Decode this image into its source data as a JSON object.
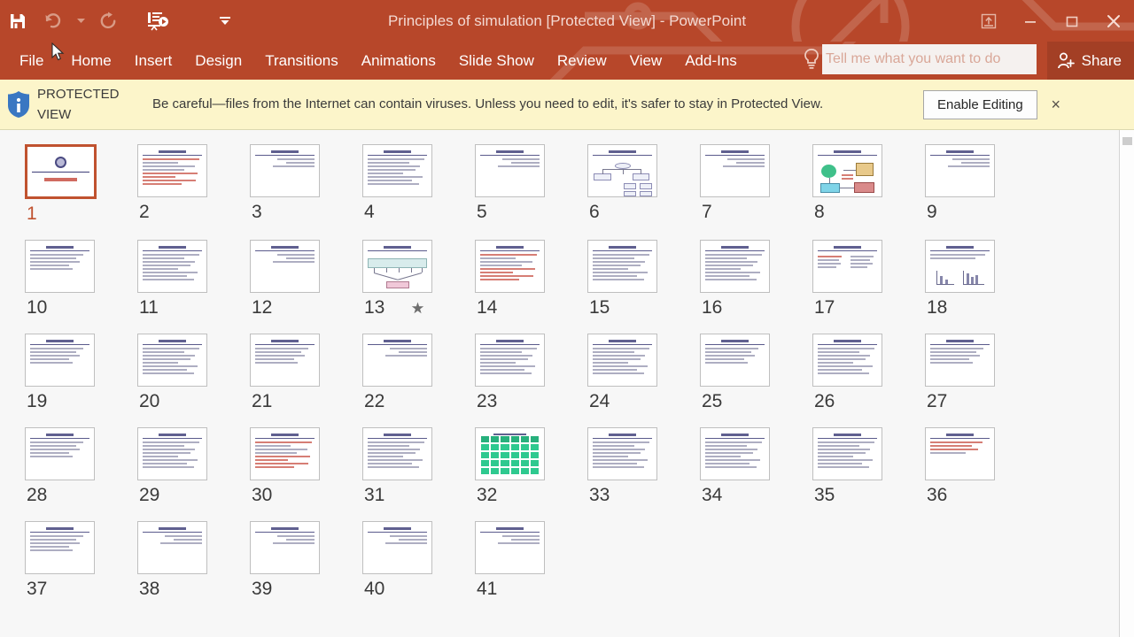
{
  "titlebar": {
    "title": "Principles of simulation [Protected View] - PowerPoint",
    "accent_color": "#b7472a",
    "quick_access": [
      {
        "name": "save-icon",
        "label": "Save",
        "enabled": true
      },
      {
        "name": "undo-icon",
        "label": "Undo",
        "enabled": false
      },
      {
        "name": "undo-dropdown-icon",
        "label": "Undo options",
        "enabled": false
      },
      {
        "name": "redo-icon",
        "label": "Redo",
        "enabled": false
      },
      {
        "name": "start-slideshow-icon",
        "label": "Start From Beginning",
        "enabled": true
      },
      {
        "name": "customize-qat-icon",
        "label": "Customize Quick Access Toolbar",
        "enabled": true
      }
    ],
    "window_controls": [
      {
        "name": "ribbon-display-options-icon",
        "label": "Ribbon Display Options"
      },
      {
        "name": "minimize-icon",
        "label": "Minimize"
      },
      {
        "name": "restore-icon",
        "label": "Restore Down"
      },
      {
        "name": "close-icon",
        "label": "Close"
      }
    ]
  },
  "menubar": {
    "items": [
      {
        "label": "File"
      },
      {
        "label": "Home"
      },
      {
        "label": "Insert"
      },
      {
        "label": "Design"
      },
      {
        "label": "Transitions"
      },
      {
        "label": "Animations"
      },
      {
        "label": "Slide Show"
      },
      {
        "label": "Review"
      },
      {
        "label": "View"
      },
      {
        "label": "Add-Ins"
      }
    ],
    "tell_me_placeholder": "Tell me what you want to do",
    "share_label": "Share"
  },
  "protected_view": {
    "badge_line1": "PROTECTED",
    "badge_line2": "VIEW",
    "message": "Be careful—files from the Internet can contain viruses. Unless you need to edit, it's safer to stay in Protected View.",
    "enable_button": "Enable Editing",
    "close_label": "×",
    "background_color": "#fcf5ca"
  },
  "slides": {
    "selected": 1,
    "selection_color": "#c0522f",
    "items": [
      {
        "num": "1",
        "kind": "title"
      },
      {
        "num": "2",
        "kind": "text-red"
      },
      {
        "num": "3",
        "kind": "sparse"
      },
      {
        "num": "4",
        "kind": "text-dense"
      },
      {
        "num": "5",
        "kind": "sparse"
      },
      {
        "num": "6",
        "kind": "diagram"
      },
      {
        "num": "7",
        "kind": "sparse"
      },
      {
        "num": "8",
        "kind": "color-diagram"
      },
      {
        "num": "9",
        "kind": "sparse"
      },
      {
        "num": "10",
        "kind": "bullets"
      },
      {
        "num": "11",
        "kind": "text-dense"
      },
      {
        "num": "12",
        "kind": "sparse"
      },
      {
        "num": "13",
        "kind": "fan-diagram",
        "animated": true
      },
      {
        "num": "14",
        "kind": "text-red"
      },
      {
        "num": "15",
        "kind": "text-dense"
      },
      {
        "num": "16",
        "kind": "text-dense"
      },
      {
        "num": "17",
        "kind": "two-col"
      },
      {
        "num": "18",
        "kind": "charts"
      },
      {
        "num": "19",
        "kind": "bullets"
      },
      {
        "num": "20",
        "kind": "text-dense"
      },
      {
        "num": "21",
        "kind": "bullets"
      },
      {
        "num": "22",
        "kind": "sparse"
      },
      {
        "num": "23",
        "kind": "text-dense"
      },
      {
        "num": "24",
        "kind": "text-dense"
      },
      {
        "num": "25",
        "kind": "bullets"
      },
      {
        "num": "26",
        "kind": "text-dense"
      },
      {
        "num": "27",
        "kind": "bullets"
      },
      {
        "num": "28",
        "kind": "bullets"
      },
      {
        "num": "29",
        "kind": "text-dense"
      },
      {
        "num": "30",
        "kind": "text-red"
      },
      {
        "num": "31",
        "kind": "text-dense"
      },
      {
        "num": "32",
        "kind": "table"
      },
      {
        "num": "33",
        "kind": "text-dense"
      },
      {
        "num": "34",
        "kind": "text-dense"
      },
      {
        "num": "35",
        "kind": "text-dense"
      },
      {
        "num": "36",
        "kind": "bullets-red"
      },
      {
        "num": "37",
        "kind": "bullets"
      },
      {
        "num": "38",
        "kind": "sparse"
      },
      {
        "num": "39",
        "kind": "sparse"
      },
      {
        "num": "40",
        "kind": "sparse"
      },
      {
        "num": "41",
        "kind": "sparse"
      }
    ]
  },
  "scrollbar": {
    "name": "vertical-scrollbar"
  }
}
